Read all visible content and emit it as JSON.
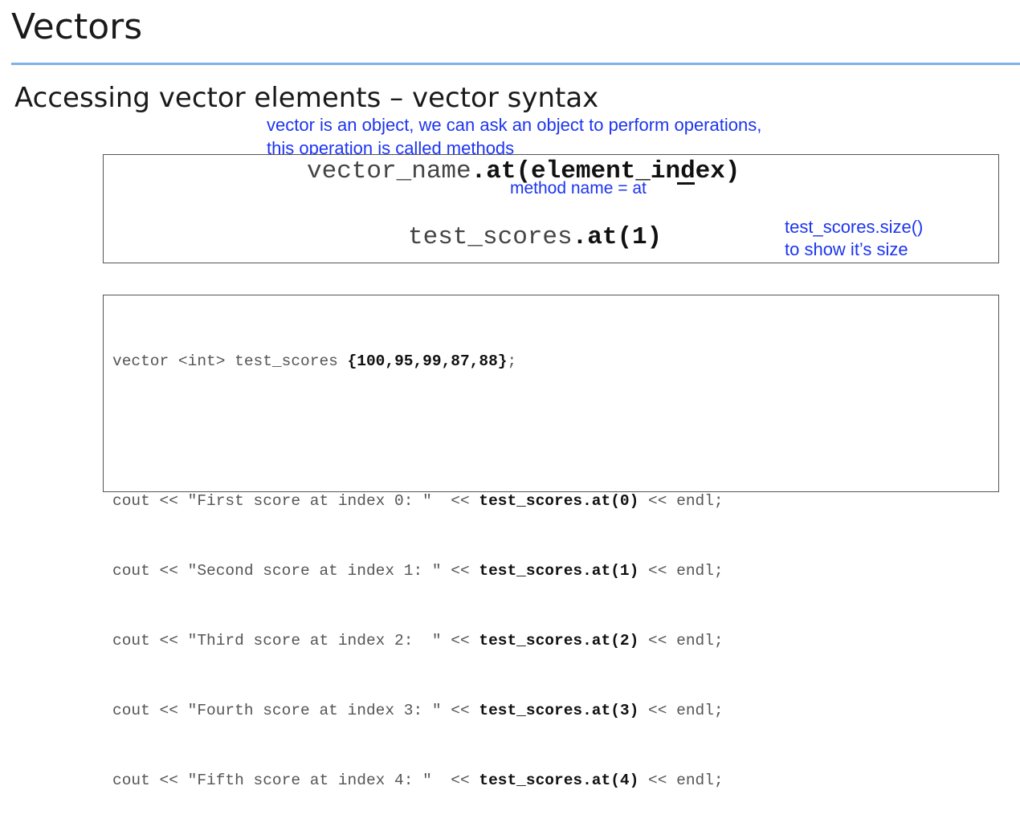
{
  "slide": {
    "title": "Vectors",
    "subtitle": "Accessing vector elements – vector syntax"
  },
  "annotations": {
    "line1": "vector is an object, we can ask an object to perform operations,",
    "line2": "this operation is called methods",
    "method_name": "method name = at",
    "size_line1": "test_scores.size()",
    "size_line2": "to show it’s size"
  },
  "syntax": {
    "line1_plain": "vector_name",
    "line1_bold": ".at(element_index)",
    "line2_plain": "test_scores",
    "line2_bold": ".at(1)"
  },
  "code": {
    "declaration_plain": "vector <int> test_scores ",
    "declaration_bold": "{100,95,99,87,88}",
    "declaration_end": ";",
    "lines": [
      {
        "prefix": "cout << \"First score at index 0: \"  << ",
        "call": "test_scores.at(0)",
        "suffix": " << endl;"
      },
      {
        "prefix": "cout << \"Second score at index 1: \" << ",
        "call": "test_scores.at(1)",
        "suffix": " << endl;"
      },
      {
        "prefix": "cout << \"Third score at index 2:  \" << ",
        "call": "test_scores.at(2)",
        "suffix": " << endl;"
      },
      {
        "prefix": "cout << \"Fourth score at index 3: \" << ",
        "call": "test_scores.at(3)",
        "suffix": " << endl;"
      },
      {
        "prefix": "cout << \"Fifth score at index 4: \"  << ",
        "call": "test_scores.at(4)",
        "suffix": " << endl;"
      }
    ]
  },
  "colors": {
    "annotation": "#1c35f0",
    "rule": "#7fb2e8"
  }
}
